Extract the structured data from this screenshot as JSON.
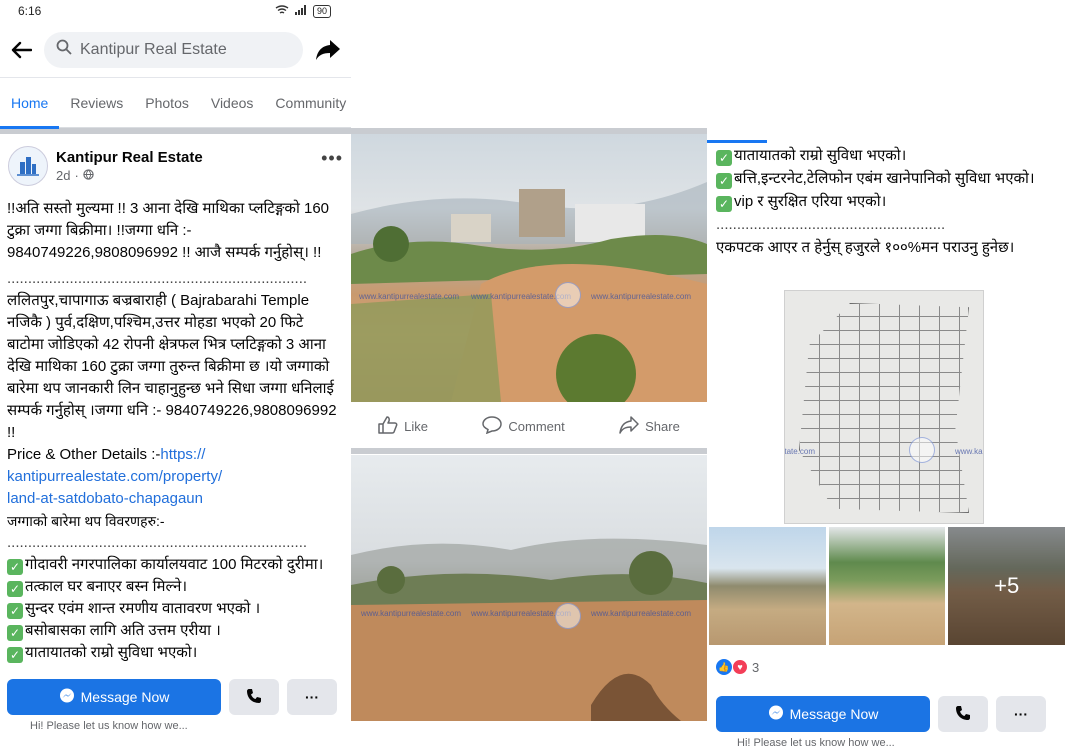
{
  "status": {
    "time": "6:16",
    "battery": "90"
  },
  "search": {
    "placeholder": "Kantipur Real Estate"
  },
  "tabs": [
    "Home",
    "Reviews",
    "Photos",
    "Videos",
    "Community"
  ],
  "post": {
    "author": "Kantipur Real Estate",
    "age": "2d",
    "intro": "!!अति सस्तो मुल्यमा !! 3 आना देखि माथिका प्लटिङ्गको 160 टुक्रा जग्गा बिक्रीमा। !!जग्गा धनि :- 9840749226,9808096992 !! आजै सम्पर्क गर्नुहोस्। !!",
    "dots": "........................................................................",
    "body": "ललितपुर,चापागाऊ बज्रबाराही ( Bajrabarahi Temple नजिकै ) पुर्व,दक्षिण,पश्चिम,उत्तर मोहडा भएको 20 फिटे बाटोमा जोडिएको 42 रोपनी क्षेत्रफल भित्र प्लटिङ्गको 3 आना देखि माथिका 160 टुक्रा जग्गा तुरुन्त बिक्रीमा छ ।यो जग्गाको बारेमा थप जानकारी लिन चाहानुहुन्छ भने सिधा जग्गा धनिलाई सम्पर्क गर्नुहोस् ।जग्गा धनि :- 9840749226,9808096992 !!",
    "price_label": "Price & Other Details :-",
    "link": "https://kantipurrealestate.com/property/land-at-satdobato-chapagaun",
    "link_parts": [
      "https://",
      "kantipurrealestate.com/property/",
      "land-at-satdobato-chapagaun"
    ],
    "more_info": "जग्गाको बारेमा थप विवरणहरु:-",
    "features_left": [
      "गोदावरी नगरपालिका कार्यालयवाट 100 मिटरको दुरीमा।",
      "तत्काल घर बनाएर बस्न मिल्ने।",
      "सुन्दर एवंम शान्त रमणीय वातावरण भएको ।",
      "बसोबासका लागि अति उत्तम एरीया ।",
      "यातायातको राम्रो सुविधा भएको।"
    ],
    "features_right": [
      "यातायातको राम्रो सुविधा भएको।",
      "बत्ति,इन्टरनेट,टेलिफोन एबंम खानेपानिको सुविधा भएको।",
      "vip र सुरक्षित एरिया भएको।"
    ],
    "closing": "एकपटक आएर त हेर्नुस् हजुरले १००%मन पराउनु हुनेछ।",
    "more_photos": "+5",
    "reaction_count": "3"
  },
  "actions": {
    "like": "Like",
    "comment": "Comment",
    "share": "Share"
  },
  "cta": {
    "message": "Message Now",
    "more": "···",
    "hint": "Hi! Please let us know how we..."
  },
  "watermark": "www.kantipurrealestate.com",
  "colors": {
    "brand_blue": "#1877f2",
    "button_blue": "#1b74e4",
    "check_green": "#5ab55e"
  }
}
